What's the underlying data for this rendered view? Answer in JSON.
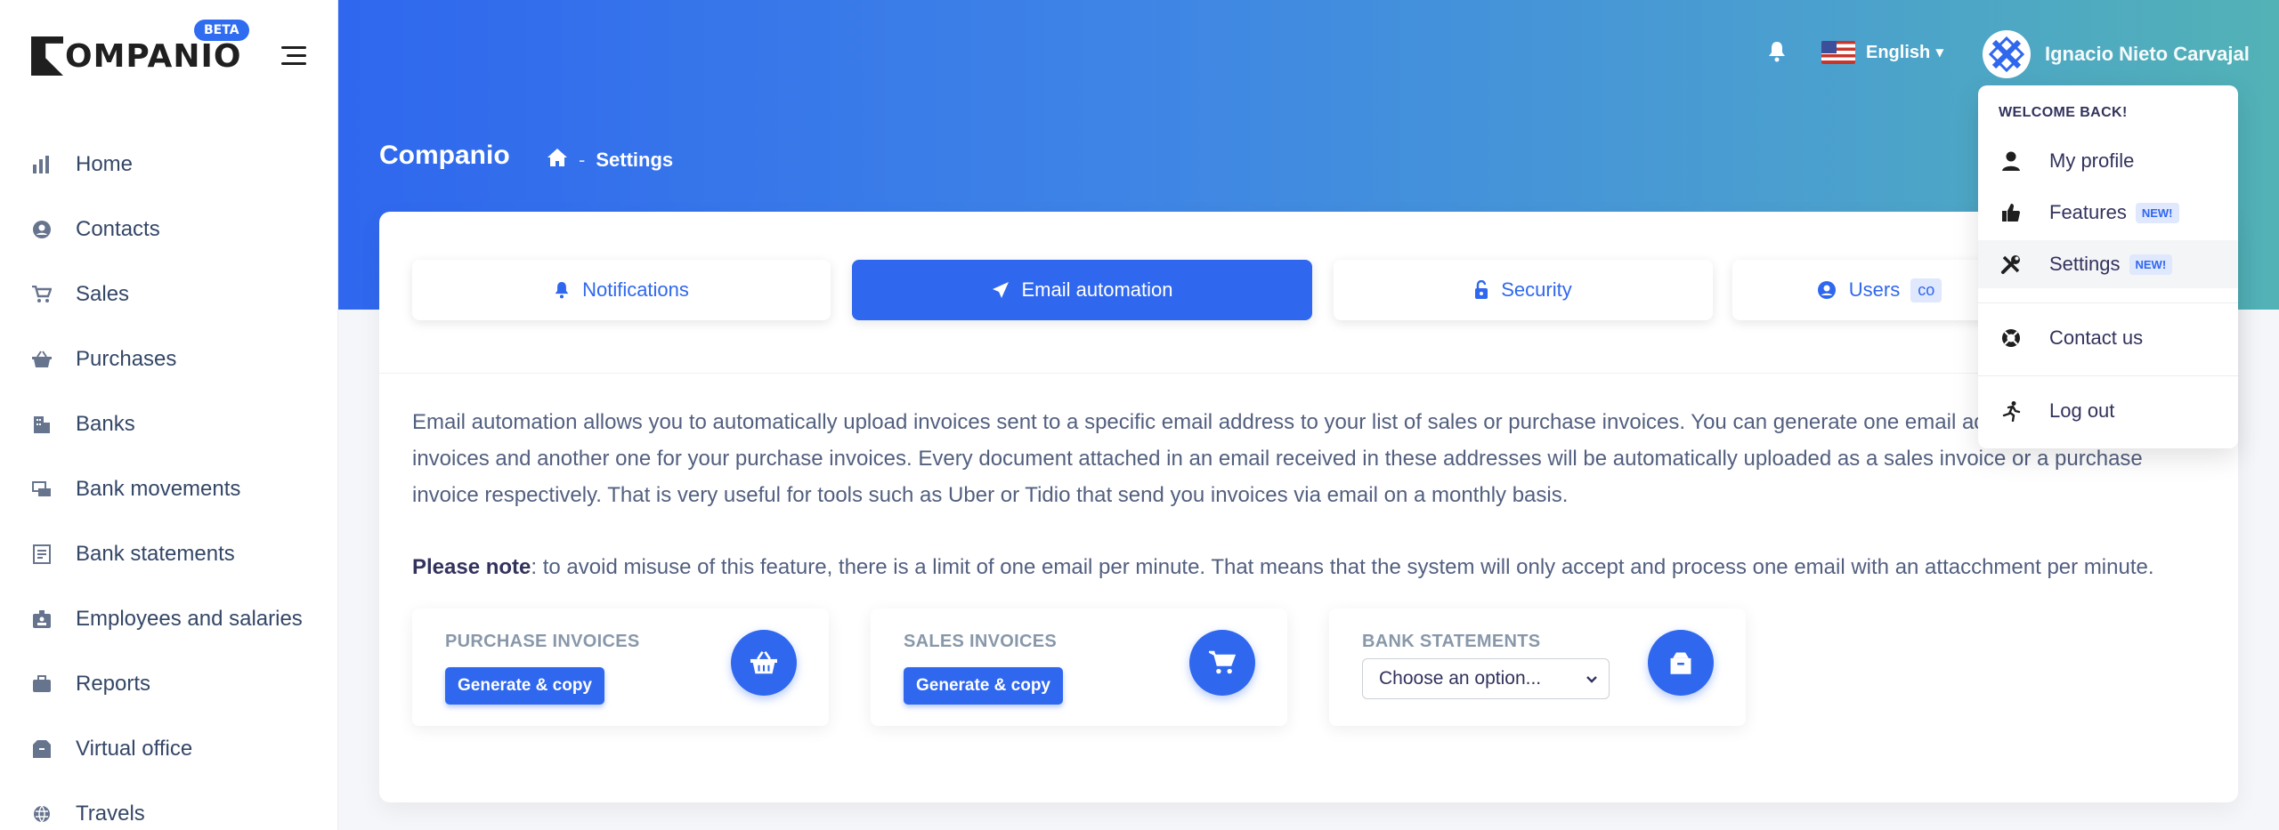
{
  "app": {
    "logo_text": "OMPANIO",
    "beta_label": "BETA"
  },
  "sidebar": {
    "items": [
      {
        "label": "Home",
        "icon": "bar-chart-icon"
      },
      {
        "label": "Contacts",
        "icon": "user-circle-icon"
      },
      {
        "label": "Sales",
        "icon": "cart-icon"
      },
      {
        "label": "Purchases",
        "icon": "basket-icon"
      },
      {
        "label": "Banks",
        "icon": "building-icon"
      },
      {
        "label": "Bank movements",
        "icon": "money-transfer-icon"
      },
      {
        "label": "Bank statements",
        "icon": "document-icon"
      },
      {
        "label": "Employees and salaries",
        "icon": "badge-icon"
      },
      {
        "label": "Reports",
        "icon": "briefcase-icon"
      },
      {
        "label": "Virtual office",
        "icon": "box-icon"
      },
      {
        "label": "Travels",
        "icon": "globe-icon"
      }
    ]
  },
  "header": {
    "title": "Companio",
    "breadcrumb_separator": "-",
    "breadcrumb_current": "Settings",
    "language": "English",
    "user_name": "Ignacio Nieto Carvajal"
  },
  "tabs": [
    {
      "label": "Notifications"
    },
    {
      "label": "Email automation"
    },
    {
      "label": "Security"
    },
    {
      "label": "Users",
      "badge": "co"
    }
  ],
  "content": {
    "description": "Email automation allows you to automatically upload invoices sent to a specific email address to your list of sales or purchase invoices. You can generate one email address for your sales invoices and another one for your purchase invoices. Every document attached in an email received in these addresses will be automatically uploaded as a sales invoice or a purchase invoice respectively. That is very useful for tools such as Uber or Tidio that send you invoices via email on a monthly basis.",
    "note_bold": "Please note",
    "note_text": ": to avoid misuse of this feature, there is a limit of one email per minute. That means that the system will only accept and process one email with an attacchment per minute.",
    "boxes": {
      "purchase_title": "PURCHASE INVOICES",
      "purchase_button": "Generate & copy",
      "sales_title": "SALES INVOICES",
      "sales_button": "Generate & copy",
      "bank_title": "BANK STATEMENTS",
      "bank_select": "Choose an option..."
    }
  },
  "dropdown": {
    "header": "WELCOME BACK!",
    "items": [
      {
        "label": "My profile",
        "icon": "person-icon"
      },
      {
        "label": "Features",
        "badge": "NEW!",
        "icon": "thumbs-up-icon"
      },
      {
        "label": "Settings",
        "badge": "NEW!",
        "icon": "tools-icon"
      },
      {
        "label": "Contact us",
        "icon": "lifebuoy-icon"
      },
      {
        "label": "Log out",
        "icon": "running-icon"
      }
    ]
  },
  "colors": {
    "primary": "#2f67ee",
    "header_gradient_start": "#2f67ee",
    "header_gradient_end": "#52b2b6"
  }
}
